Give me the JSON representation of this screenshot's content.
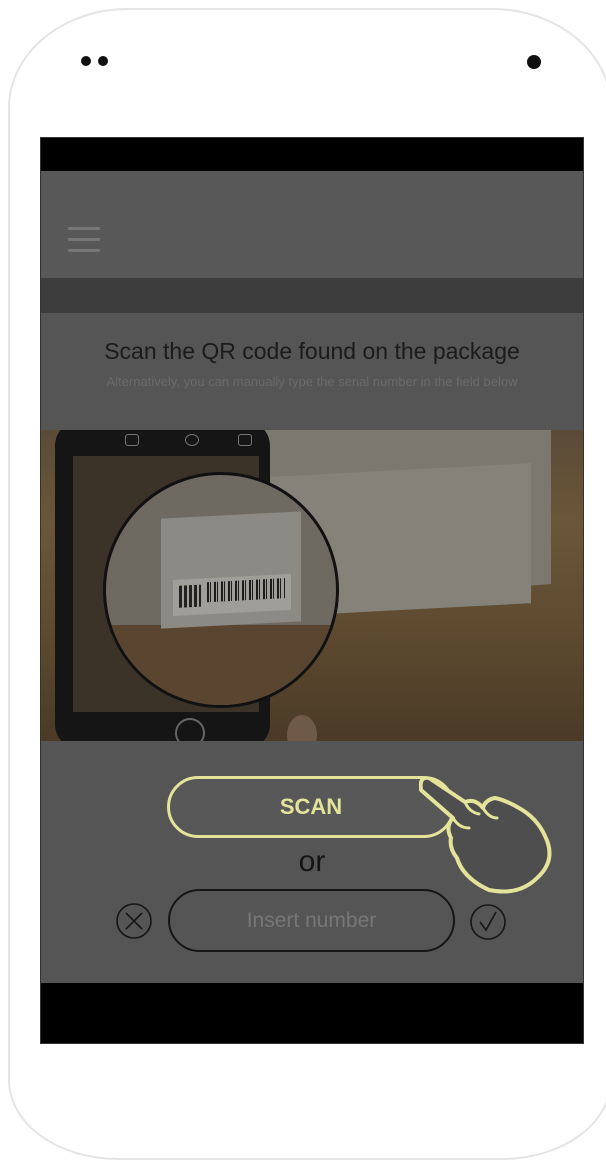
{
  "device": {
    "front_sensors": [
      "sensor-dot",
      "sensor-dot"
    ],
    "camera_icon": "front-camera-icon"
  },
  "app_bar": {
    "menu_icon": "hamburger-menu-icon"
  },
  "instructions": {
    "title": "Scan the QR code found on the package",
    "subtitle": "Alternatively, you can manually type the serial number in the field below"
  },
  "illustration": {
    "description_icon": "phone-scanning-barcode-image"
  },
  "actions": {
    "scan_label": "SCAN",
    "or_label": "or",
    "number_placeholder": "Insert number",
    "clear_icon": "close-circle-icon",
    "confirm_icon": "checkmark-circle-icon",
    "pointer_icon": "tap-hand-icon",
    "accent_color": "#e3e39a"
  }
}
